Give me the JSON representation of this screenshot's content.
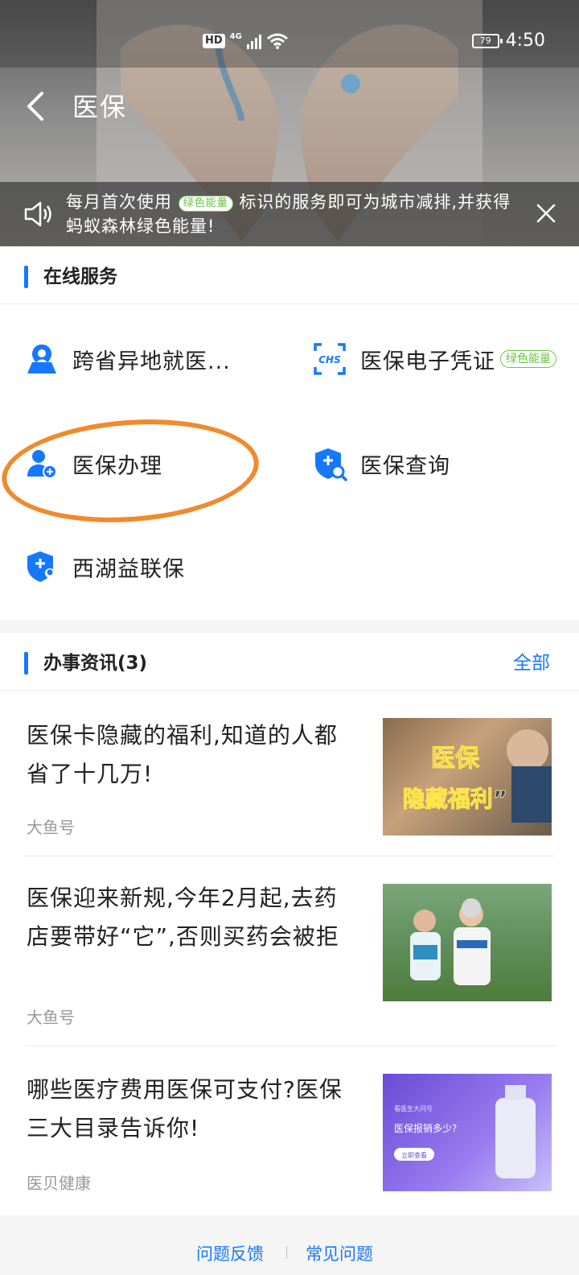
{
  "status_bar": {
    "hd": "HD",
    "network": "4G",
    "battery": "79",
    "time": "4:50"
  },
  "nav": {
    "title": "医保",
    "back_icon": "chevron-left-icon"
  },
  "notice": {
    "text_before": "每月首次使用",
    "green_tag": "绿色能量",
    "text_after": "标识的服务即可为城市减排,并获得蚂蚁森林绿色能量!",
    "speaker_icon": "speaker-icon",
    "close_icon": "close-icon"
  },
  "online_services": {
    "title": "在线服务",
    "items": [
      {
        "label": "跨省异地就医...",
        "icon": "map-pin-person-icon"
      },
      {
        "label": "医保电子凭证",
        "icon": "chs-scan-icon",
        "badge": "绿色能量"
      },
      {
        "label": "医保办理",
        "icon": "user-add-icon"
      },
      {
        "label": "医保查询",
        "icon": "shield-search-icon"
      },
      {
        "label": "西湖益联保",
        "icon": "shield-user-icon"
      }
    ]
  },
  "news": {
    "title": "办事资讯(3)",
    "more": "全部",
    "items": [
      {
        "title": "医保卡隐藏的福利,知道的人都省了十几万!",
        "source": "大鱼号",
        "thumb_text": [
          "医保",
          "隐藏福利”"
        ]
      },
      {
        "title": "医保迎来新规,今年2月起,去药店要带好“它”,否则买药会被拒",
        "source": "大鱼号"
      },
      {
        "title": "哪些医疗费用医保可支付?医保三大目录告诉你!",
        "source": "医贝健康",
        "thumb_text": [
          "看医生大问号",
          "医保报销多少?",
          "立即查看"
        ]
      }
    ]
  },
  "footer": {
    "feedback": "问题反馈",
    "faq": "常见问题"
  },
  "colors": {
    "accent": "#1677ff",
    "green": "#6cc24a",
    "highlight": "#f08a2c"
  }
}
